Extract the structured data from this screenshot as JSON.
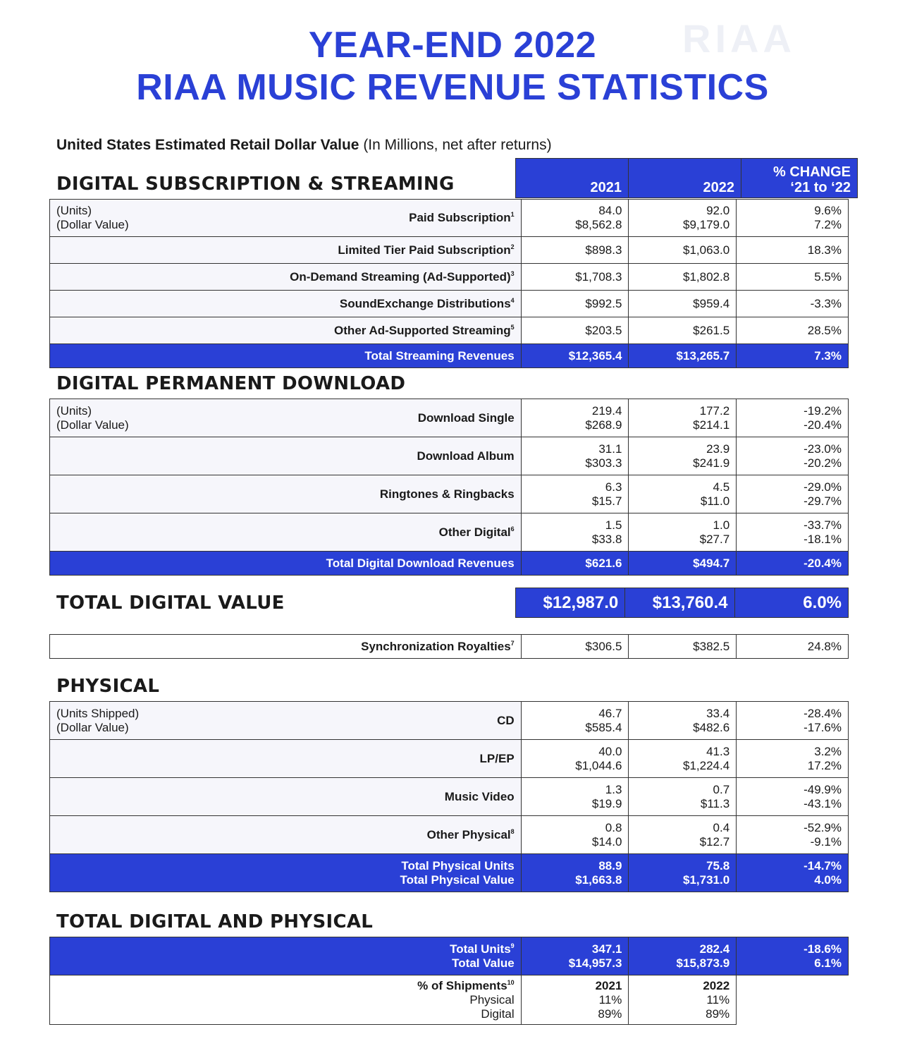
{
  "title_line1": "YEAR-END 2022",
  "title_line2": "RIAA MUSIC REVENUE STATISTICS",
  "watermark": "RIAA",
  "subtitle_bold": "United States Estimated Retail Dollar Value",
  "subtitle_rest": "(In Millions, net after returns)",
  "headers": {
    "y2021": "2021",
    "y2022": "2022",
    "change_line1": "% CHANGE",
    "change_line2": "‘21 to ‘22"
  },
  "streaming": {
    "heading": "DIGITAL SUBSCRIPTION & STREAMING",
    "rows": [
      {
        "units": "(Units)",
        "dollar": "(Dollar Value)",
        "label": "Paid Subscription",
        "sup": "1",
        "v2021a": "84.0",
        "v2021b": "$8,562.8",
        "v2022a": "92.0",
        "v2022b": "$9,179.0",
        "pa": "9.6%",
        "pb": "7.2%"
      },
      {
        "label": "Limited Tier Paid Subscription",
        "sup": "2",
        "v2021": "$898.3",
        "v2022": "$1,063.0",
        "pct": "18.3%"
      },
      {
        "label": "On-Demand Streaming (Ad-Supported)",
        "sup": "3",
        "v2021": "$1,708.3",
        "v2022": "$1,802.8",
        "pct": "5.5%"
      },
      {
        "label": "SoundExchange Distributions",
        "sup": "4",
        "v2021": "$992.5",
        "v2022": "$959.4",
        "pct": "-3.3%"
      },
      {
        "label": "Other Ad-Supported Streaming",
        "sup": "5",
        "v2021": "$203.5",
        "v2022": "$261.5",
        "pct": "28.5%"
      }
    ],
    "total": {
      "label": "Total Streaming Revenues",
      "v2021": "$12,365.4",
      "v2022": "$13,265.7",
      "pct": "7.3%"
    }
  },
  "download": {
    "heading": "DIGITAL PERMANENT DOWNLOAD",
    "units": "(Units)",
    "dollar": "(Dollar Value)",
    "rows": [
      {
        "label": "Download Single",
        "sup": "",
        "v2021a": "219.4",
        "v2021b": "$268.9",
        "v2022a": "177.2",
        "v2022b": "$214.1",
        "pa": "-19.2%",
        "pb": "-20.4%"
      },
      {
        "label": "Download Album",
        "sup": "",
        "v2021a": "31.1",
        "v2021b": "$303.3",
        "v2022a": "23.9",
        "v2022b": "$241.9",
        "pa": "-23.0%",
        "pb": "-20.2%"
      },
      {
        "label": "Ringtones & Ringbacks",
        "sup": "",
        "v2021a": "6.3",
        "v2021b": "$15.7",
        "v2022a": "4.5",
        "v2022b": "$11.0",
        "pa": "-29.0%",
        "pb": "-29.7%"
      },
      {
        "label": "Other Digital",
        "sup": "6",
        "v2021a": "1.5",
        "v2021b": "$33.8",
        "v2022a": "1.0",
        "v2022b": "$27.7",
        "pa": "-33.7%",
        "pb": "-18.1%"
      }
    ],
    "total": {
      "label": "Total Digital Download Revenues",
      "v2021": "$621.6",
      "v2022": "$494.7",
      "pct": "-20.4%"
    }
  },
  "total_digital": {
    "heading": "TOTAL DIGITAL VALUE",
    "v2021": "$12,987.0",
    "v2022": "$13,760.4",
    "pct": "6.0%"
  },
  "sync": {
    "label": "Synchronization Royalties",
    "sup": "7",
    "v2021": "$306.5",
    "v2022": "$382.5",
    "pct": "24.8%"
  },
  "physical": {
    "heading": "PHYSICAL",
    "units": "(Units Shipped)",
    "dollar": "(Dollar Value)",
    "rows": [
      {
        "label": "CD",
        "sup": "",
        "v2021a": "46.7",
        "v2021b": "$585.4",
        "v2022a": "33.4",
        "v2022b": "$482.6",
        "pa": "-28.4%",
        "pb": "-17.6%"
      },
      {
        "label": "LP/EP",
        "sup": "",
        "v2021a": "40.0",
        "v2021b": "$1,044.6",
        "v2022a": "41.3",
        "v2022b": "$1,224.4",
        "pa": "3.2%",
        "pb": "17.2%"
      },
      {
        "label": "Music Video",
        "sup": "",
        "v2021a": "1.3",
        "v2021b": "$19.9",
        "v2022a": "0.7",
        "v2022b": "$11.3",
        "pa": "-49.9%",
        "pb": "-43.1%"
      },
      {
        "label": "Other Physical",
        "sup": "8",
        "v2021a": "0.8",
        "v2021b": "$14.0",
        "v2022a": "0.4",
        "v2022b": "$12.7",
        "pa": "-52.9%",
        "pb": "-9.1%"
      }
    ],
    "total": {
      "label_a": "Total Physical Units",
      "label_b": "Total Physical Value",
      "v2021a": "88.9",
      "v2021b": "$1,663.8",
      "v2022a": "75.8",
      "v2022b": "$1,731.0",
      "pa": "-14.7%",
      "pb": "4.0%"
    }
  },
  "combined": {
    "heading": "TOTAL DIGITAL AND PHYSICAL",
    "total": {
      "label_a": "Total Units",
      "sup": "9",
      "label_b": "Total Value",
      "v2021a": "347.1",
      "v2021b": "$14,957.3",
      "v2022a": "282.4",
      "v2022b": "$15,873.9",
      "pa": "-18.6%",
      "pb": "6.1%"
    },
    "shipments": {
      "label": "% of Shipments",
      "sup": "10",
      "physical": "Physical",
      "digital": "Digital",
      "y2021": "2021",
      "y2022": "2022",
      "p2021": "11%",
      "d2021": "89%",
      "p2022": "11%",
      "d2022": "89%"
    }
  }
}
